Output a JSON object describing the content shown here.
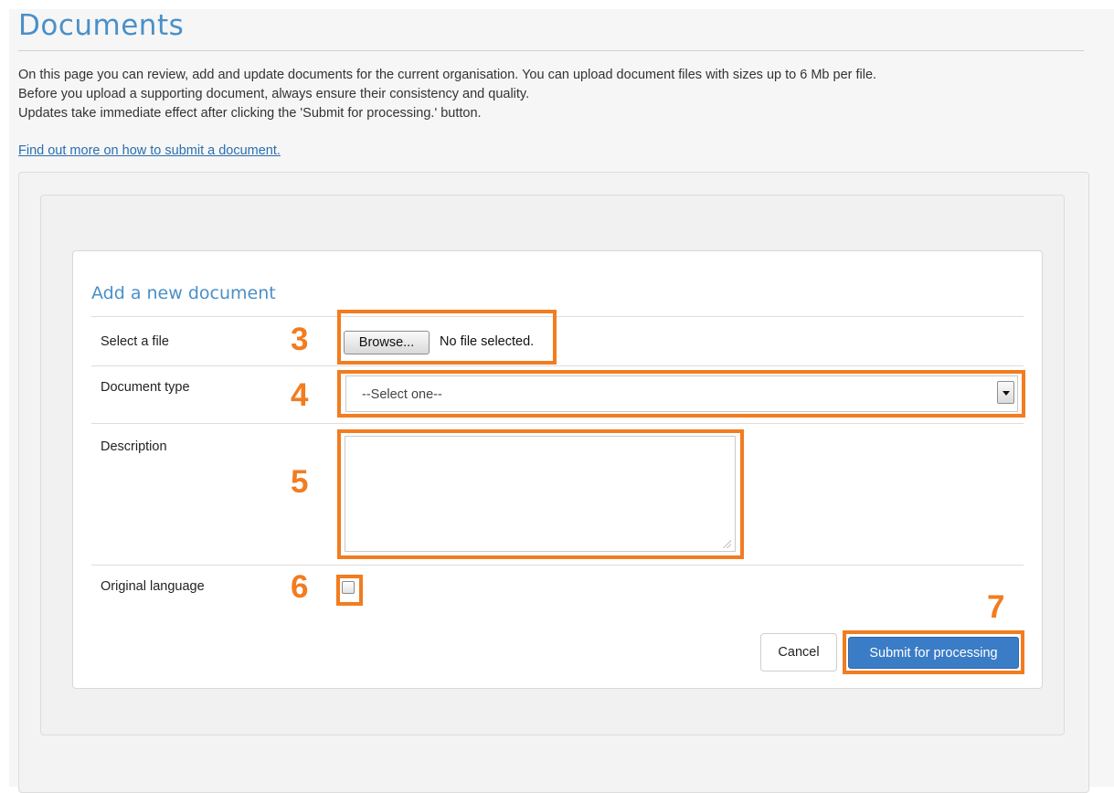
{
  "page": {
    "title": "Documents",
    "intro_lines": [
      "On this page you can review, add and update documents for the current organisation. You can upload document files with sizes up to 6 Mb per file.",
      "Before you upload a supporting document, always ensure their consistency and quality.",
      "Updates take immediate effect after clicking the 'Submit for processing.' button."
    ],
    "help_link": "Find out more on how to submit a document."
  },
  "form": {
    "title": "Add a new document",
    "file": {
      "label": "Select a file",
      "browse_label": "Browse...",
      "status": "No file selected."
    },
    "document_type": {
      "label": "Document type",
      "selected": "--Select one--"
    },
    "description": {
      "label": "Description",
      "value": ""
    },
    "original_language": {
      "label": "Original language",
      "checked": false
    },
    "cancel_label": "Cancel",
    "submit_label": "Submit for processing"
  },
  "annotations": {
    "callout_color": "#f27c1f",
    "numbers": [
      "3",
      "4",
      "5",
      "6",
      "7"
    ]
  },
  "colors": {
    "heading": "#4a90c8",
    "link": "#2a6fb0",
    "primary_button": "#3a7cc6"
  }
}
